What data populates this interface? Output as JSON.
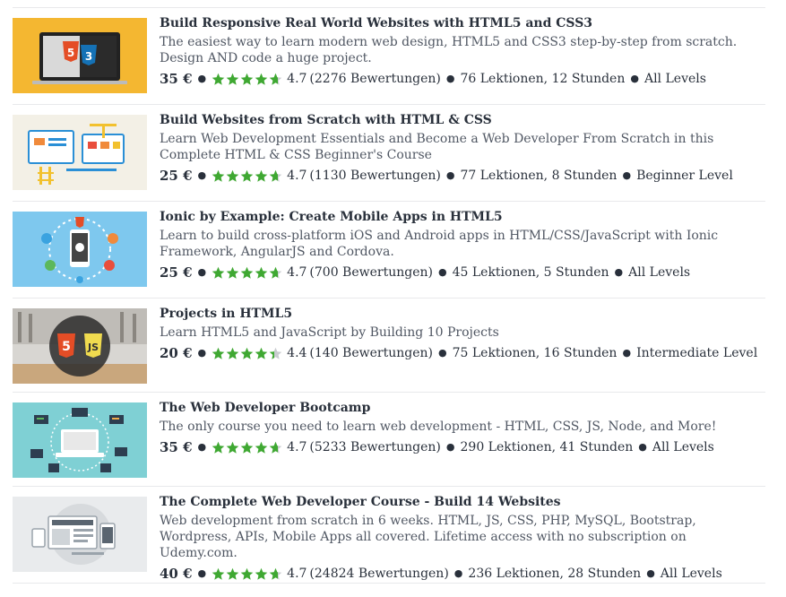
{
  "currency": "€",
  "colors": {
    "star": "#3fa832",
    "star_empty": "#c9ccd0",
    "title": "#29303b",
    "text": "#505763"
  },
  "courses": [
    {
      "title": "Build Responsive Real World Websites with HTML5 and CSS3",
      "headline": "The easiest way to learn modern web design, HTML5 and CSS3 step-by-step from scratch. Design AND code a huge project.",
      "price": "35 €",
      "rating": 4.7,
      "rating_text": "4.7",
      "reviews": "(2276 Bewertungen)",
      "lectures": "76 Lektionen, 12 Stunden",
      "level": "All Levels",
      "thumb_icon": "html5-css3-laptop-icon"
    },
    {
      "title": "Build Websites from Scratch with HTML & CSS",
      "headline": "Learn Web Development Essentials and Become a Web Developer From Scratch in this Complete HTML & CSS Beginner's Course",
      "price": "25 €",
      "rating": 4.7,
      "rating_text": "4.7",
      "reviews": "(1130 Bewertungen)",
      "lectures": "77 Lektionen, 8 Stunden",
      "level": "Beginner Level",
      "thumb_icon": "website-construction-icon"
    },
    {
      "title": "Ionic by Example: Create Mobile Apps in HTML5",
      "headline": "Learn to build cross-platform iOS and Android apps in HTML/CSS/JavaScript with Ionic Framework, AngularJS and Cordova.",
      "price": "25 €",
      "rating": 4.7,
      "rating_text": "4.7",
      "reviews": "(700 Bewertungen)",
      "lectures": "45 Lektionen, 5 Stunden",
      "level": "All Levels",
      "thumb_icon": "mobile-apps-icon"
    },
    {
      "title": "Projects in HTML5",
      "headline": "Learn HTML5 and JavaScript by Building 10 Projects",
      "price": "20 €",
      "rating": 4.4,
      "rating_text": "4.4",
      "reviews": "(140 Bewertungen)",
      "lectures": "75 Lektionen, 16 Stunden",
      "level": "Intermediate Level",
      "thumb_icon": "html5-js-badge-icon"
    },
    {
      "title": "The Web Developer Bootcamp",
      "headline": "The only course you need to learn web development - HTML, CSS, JS, Node, and More!",
      "price": "35 €",
      "rating": 4.7,
      "rating_text": "4.7",
      "reviews": "(5233 Bewertungen)",
      "lectures": "290 Lektionen, 41 Stunden",
      "level": "All Levels",
      "thumb_icon": "laptop-code-icon"
    },
    {
      "title": "The Complete Web Developer Course - Build 14 Websites",
      "headline": "Web development from scratch in 6 weeks. HTML, JS, CSS, PHP, MySQL, Bootstrap, Wordpress, APIs, Mobile Apps all covered. Lifetime access with no subscription on Udemy.com.",
      "price": "40 €",
      "rating": 4.7,
      "rating_text": "4.7",
      "reviews": "(24824 Bewertungen)",
      "lectures": "236 Lektionen, 28 Stunden",
      "level": "All Levels",
      "thumb_icon": "web-developer-devices-icon"
    }
  ]
}
